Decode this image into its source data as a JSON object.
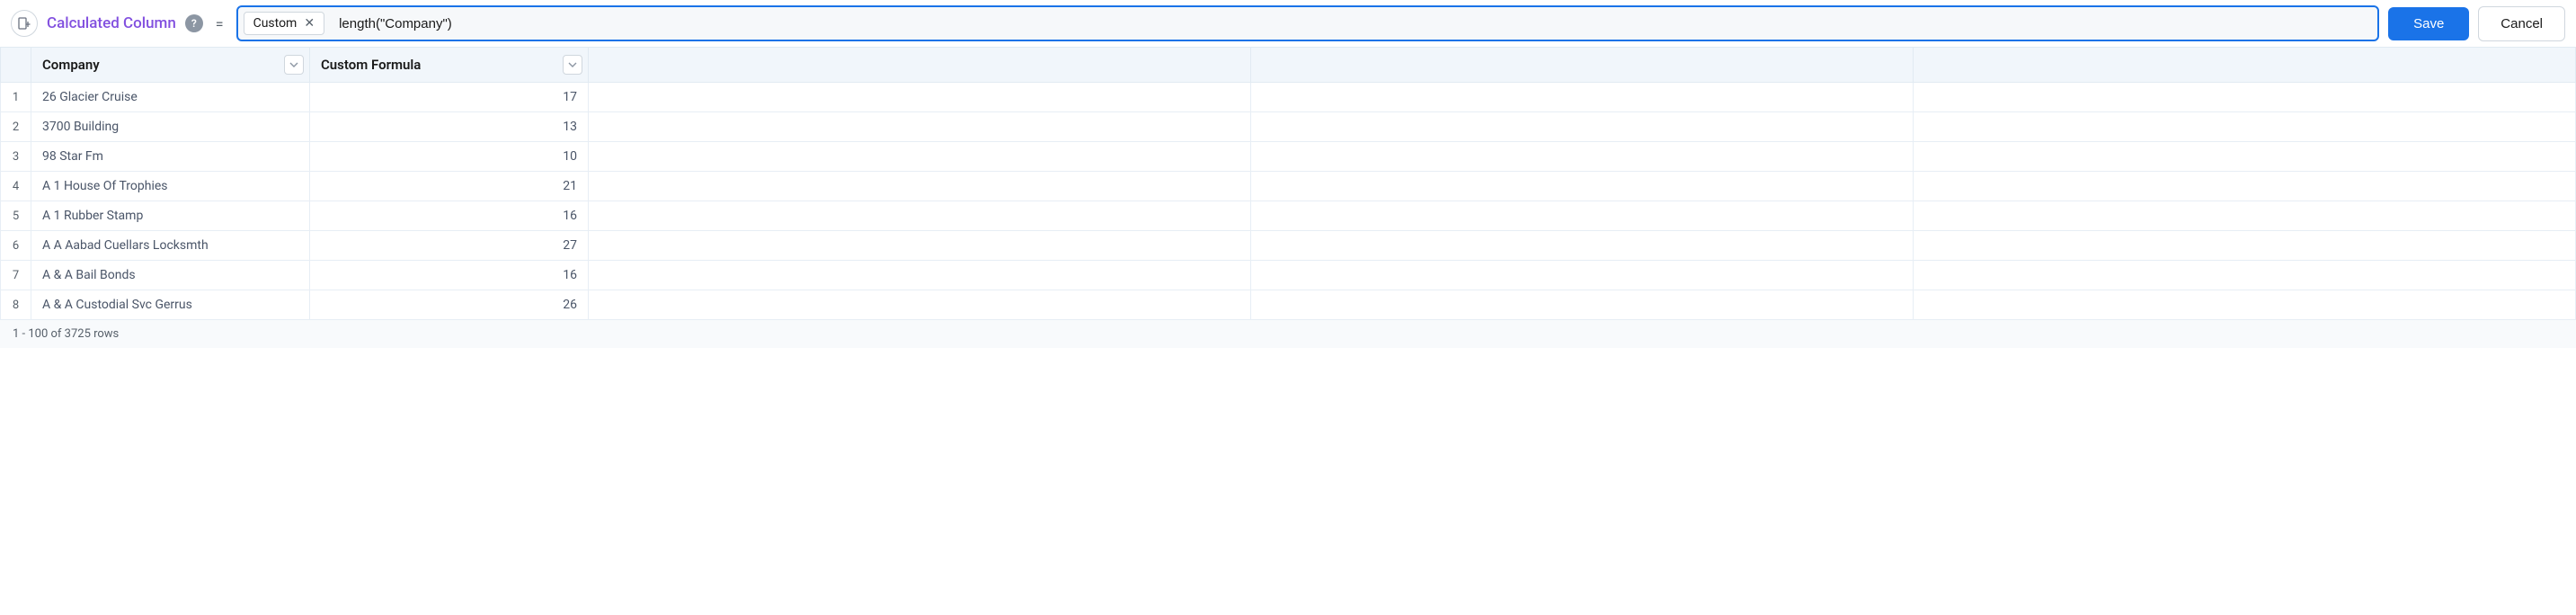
{
  "toolbar": {
    "title": "Calculated Column",
    "help_tooltip": "?",
    "equals": "=",
    "tag_label": "Custom",
    "formula_value": "length(\"Company\")",
    "save_label": "Save",
    "cancel_label": "Cancel"
  },
  "columns": {
    "company": "Company",
    "formula": "Custom Formula",
    "empty1": "",
    "empty2": "",
    "empty3": ""
  },
  "rows": [
    {
      "n": "1",
      "company": "26 Glacier Cruise",
      "value": "17"
    },
    {
      "n": "2",
      "company": "3700 Building",
      "value": "13"
    },
    {
      "n": "3",
      "company": "98 Star Fm",
      "value": "10"
    },
    {
      "n": "4",
      "company": "A 1 House Of Trophies",
      "value": "21"
    },
    {
      "n": "5",
      "company": "A 1 Rubber Stamp",
      "value": "16"
    },
    {
      "n": "6",
      "company": "A A Aabad Cuellars Locksmth",
      "value": "27"
    },
    {
      "n": "7",
      "company": "A & A Bail Bonds",
      "value": "16"
    },
    {
      "n": "8",
      "company": "A & A Custodial Svc Gerrus",
      "value": "26"
    }
  ],
  "footer": {
    "status": "1 - 100 of 3725 rows"
  }
}
